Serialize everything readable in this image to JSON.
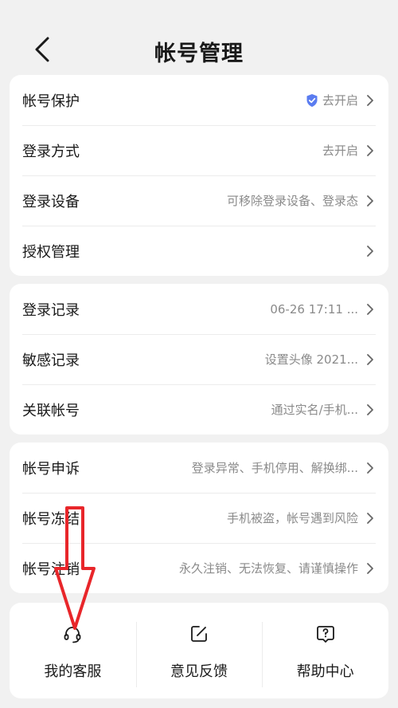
{
  "header": {
    "title": "帐号管理",
    "back_icon": "chevron-left-icon"
  },
  "groups": [
    {
      "rows": [
        {
          "label": "帐号保护",
          "value": "去开启",
          "icon": "shield-check-icon"
        },
        {
          "label": "登录方式",
          "value": "去开启"
        },
        {
          "label": "登录设备",
          "value": "可移除登录设备、登录态"
        },
        {
          "label": "授权管理",
          "value": ""
        }
      ]
    },
    {
      "rows": [
        {
          "label": "登录记录",
          "value": "06-26 17:11 ..."
        },
        {
          "label": "敏感记录",
          "value": "设置头像 2021..."
        },
        {
          "label": "关联帐号",
          "value": "通过实名/手机..."
        }
      ]
    },
    {
      "rows": [
        {
          "label": "帐号申诉",
          "value": "登录异常、手机停用、解换绑..."
        },
        {
          "label": "帐号冻结",
          "value": "手机被盗，帐号遇到风险"
        },
        {
          "label": "帐号注销",
          "value": "永久注销、无法恢复、请谨慎操作"
        }
      ]
    }
  ],
  "bottom": [
    {
      "label": "我的客服",
      "icon": "headset-icon"
    },
    {
      "label": "意见反馈",
      "icon": "edit-icon"
    },
    {
      "label": "帮助中心",
      "icon": "help-icon"
    }
  ],
  "colors": {
    "accent": "#5a7cf0",
    "annotation": "#e8262a",
    "background": "#f1f1f1"
  }
}
